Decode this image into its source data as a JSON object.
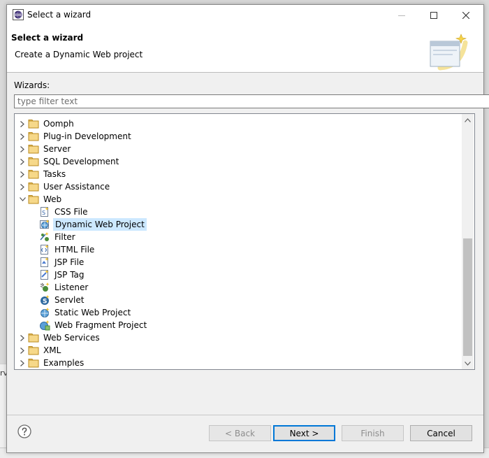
{
  "window": {
    "title": "Select a wizard"
  },
  "header": {
    "title": "Select a wizard",
    "subtitle": "Create a Dynamic Web project"
  },
  "wizards_label": "Wizards:",
  "filter": {
    "placeholder": "type filter text",
    "value": ""
  },
  "tree": {
    "items": [
      {
        "label": "Oomph",
        "level": 0,
        "expanded": false,
        "icon": "folder-icon"
      },
      {
        "label": "Plug-in Development",
        "level": 0,
        "expanded": false,
        "icon": "folder-icon"
      },
      {
        "label": "Server",
        "level": 0,
        "expanded": false,
        "icon": "folder-icon"
      },
      {
        "label": "SQL Development",
        "level": 0,
        "expanded": false,
        "icon": "folder-icon"
      },
      {
        "label": "Tasks",
        "level": 0,
        "expanded": false,
        "icon": "folder-icon"
      },
      {
        "label": "User Assistance",
        "level": 0,
        "expanded": false,
        "icon": "folder-icon"
      },
      {
        "label": "Web",
        "level": 0,
        "expanded": true,
        "icon": "folder-icon"
      },
      {
        "label": "CSS File",
        "level": 1,
        "icon": "css-file-icon"
      },
      {
        "label": "Dynamic Web Project",
        "level": 1,
        "icon": "dynamic-web-project-icon",
        "selected": true
      },
      {
        "label": "Filter",
        "level": 1,
        "icon": "filter-icon"
      },
      {
        "label": "HTML File",
        "level": 1,
        "icon": "html-file-icon"
      },
      {
        "label": "JSP File",
        "level": 1,
        "icon": "jsp-file-icon"
      },
      {
        "label": "JSP Tag",
        "level": 1,
        "icon": "jsp-tag-icon"
      },
      {
        "label": "Listener",
        "level": 1,
        "icon": "listener-icon"
      },
      {
        "label": "Servlet",
        "level": 1,
        "icon": "servlet-icon"
      },
      {
        "label": "Static Web Project",
        "level": 1,
        "icon": "static-web-project-icon"
      },
      {
        "label": "Web Fragment Project",
        "level": 1,
        "icon": "web-fragment-project-icon"
      },
      {
        "label": "Web Services",
        "level": 0,
        "expanded": false,
        "icon": "folder-icon"
      },
      {
        "label": "XML",
        "level": 0,
        "expanded": false,
        "icon": "folder-icon"
      },
      {
        "label": "Examples",
        "level": 0,
        "expanded": false,
        "icon": "folder-icon"
      }
    ]
  },
  "buttons": {
    "back": "< Back",
    "next": "Next >",
    "finish": "Finish",
    "cancel": "Cancel"
  },
  "colors": {
    "selection": "#cce8ff",
    "default_button_border": "#0078d7",
    "folder": "#e8b84a"
  }
}
